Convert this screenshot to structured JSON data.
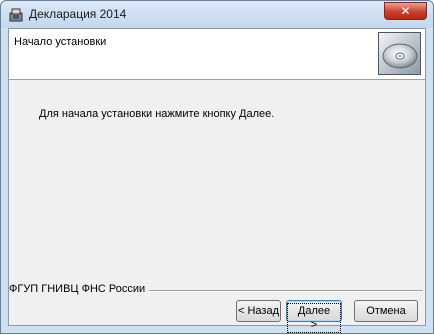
{
  "window": {
    "title": "Декларация 2014",
    "close_symbol": "✕",
    "app_icon": "installer-app-icon"
  },
  "header": {
    "title": "Начало установки",
    "icon": "cd-disc-icon"
  },
  "body": {
    "instruction": "Для начала установки нажмите кнопку Далее."
  },
  "footer": {
    "brand": "ФГУП ГНИВЦ ФНС России",
    "back_label": "< Назад",
    "next_label": "Далее >",
    "cancel_label": "Отмена"
  }
}
